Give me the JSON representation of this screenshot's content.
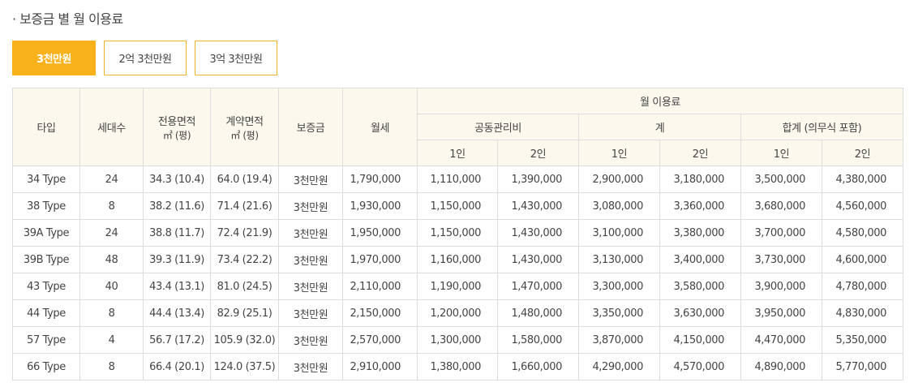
{
  "title": "· 보증금 별 월 이용료",
  "tabs": [
    {
      "label": "3천만원",
      "active": true
    },
    {
      "label": "2억 3천만원",
      "active": false
    },
    {
      "label": "3억 3천만원",
      "active": false
    }
  ],
  "table": {
    "headers": {
      "type": "타입",
      "units": "세대수",
      "exclusive_area": "전용면적",
      "exclusive_unit": "㎡ (평)",
      "contract_area": "계약면적",
      "contract_unit": "㎡ (평)",
      "deposit": "보증금",
      "rent": "월세",
      "monthly_fee": "월 이용료",
      "maintenance": "공동관리비",
      "subtotal": "계",
      "total": "합계 (의무식 포함)",
      "one_person": "1인",
      "two_person": "2인"
    },
    "rows": [
      {
        "type": "34 Type",
        "units": "24",
        "exclusive": "34.3 (10.4)",
        "contract": "64.0 (19.4)",
        "deposit": "3천만원",
        "rent": "1,790,000",
        "m1": "1,110,000",
        "m2": "1,390,000",
        "s1": "2,900,000",
        "s2": "3,180,000",
        "t1": "3,500,000",
        "t2": "4,380,000"
      },
      {
        "type": "38 Type",
        "units": "8",
        "exclusive": "38.2 (11.6)",
        "contract": "71.4 (21.6)",
        "deposit": "3천만원",
        "rent": "1,930,000",
        "m1": "1,150,000",
        "m2": "1,430,000",
        "s1": "3,080,000",
        "s2": "3,360,000",
        "t1": "3,680,000",
        "t2": "4,560,000"
      },
      {
        "type": "39A Type",
        "units": "24",
        "exclusive": "38.8 (11.7)",
        "contract": "72.4 (21.9)",
        "deposit": "3천만원",
        "rent": "1,950,000",
        "m1": "1,150,000",
        "m2": "1,430,000",
        "s1": "3,100,000",
        "s2": "3,380,000",
        "t1": "3,700,000",
        "t2": "4,580,000"
      },
      {
        "type": "39B Type",
        "units": "48",
        "exclusive": "39.3 (11.9)",
        "contract": "73.4 (22.2)",
        "deposit": "3천만원",
        "rent": "1,970,000",
        "m1": "1,160,000",
        "m2": "1,430,000",
        "s1": "3,130,000",
        "s2": "3,400,000",
        "t1": "3,730,000",
        "t2": "4,600,000"
      },
      {
        "type": "43 Type",
        "units": "40",
        "exclusive": "43.4 (13.1)",
        "contract": "81.0 (24.5)",
        "deposit": "3천만원",
        "rent": "2,110,000",
        "m1": "1,190,000",
        "m2": "1,470,000",
        "s1": "3,300,000",
        "s2": "3,580,000",
        "t1": "3,900,000",
        "t2": "4,780,000"
      },
      {
        "type": "44 Type",
        "units": "8",
        "exclusive": "44.4 (13.4)",
        "contract": "82.9 (25.1)",
        "deposit": "3천만원",
        "rent": "2,150,000",
        "m1": "1,200,000",
        "m2": "1,480,000",
        "s1": "3,350,000",
        "s2": "3,630,000",
        "t1": "3,950,000",
        "t2": "4,830,000"
      },
      {
        "type": "57 Type",
        "units": "4",
        "exclusive": "56.7 (17.2)",
        "contract": "105.9 (32.0)",
        "deposit": "3천만원",
        "rent": "2,570,000",
        "m1": "1,300,000",
        "m2": "1,580,000",
        "s1": "3,870,000",
        "s2": "4,150,000",
        "t1": "4,470,000",
        "t2": "5,350,000"
      },
      {
        "type": "66 Type",
        "units": "8",
        "exclusive": "66.4 (20.1)",
        "contract": "124.0 (37.5)",
        "deposit": "3천만원",
        "rent": "2,910,000",
        "m1": "1,380,000",
        "m2": "1,660,000",
        "s1": "4,290,000",
        "s2": "4,570,000",
        "t1": "4,890,000",
        "t2": "5,770,000"
      }
    ]
  },
  "colors": {
    "accent": "#f9b21c",
    "header_bg": "#fcf8ee",
    "border": "#dddddd"
  }
}
